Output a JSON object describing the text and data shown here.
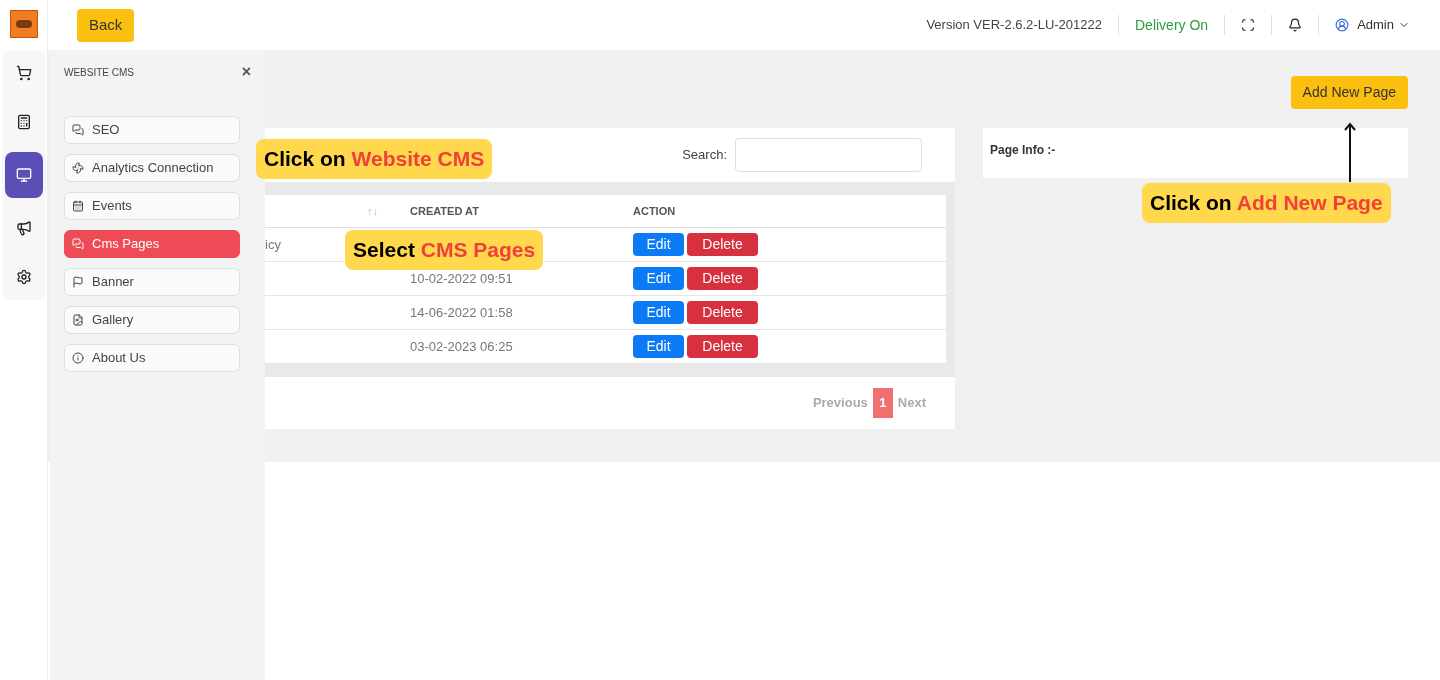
{
  "header": {
    "back": "Back",
    "version": "Version VER-2.6.2-LU-201222",
    "delivery": "Delivery On",
    "user": "Admin"
  },
  "rail": [
    {
      "selected": false
    },
    {
      "selected": false
    },
    {
      "selected": true
    },
    {
      "selected": false
    },
    {
      "selected": false
    }
  ],
  "drawer": {
    "title": "WEBSITE CMS",
    "close": "×",
    "items": [
      {
        "label": "SEO",
        "selected": false
      },
      {
        "label": "Analytics Connection",
        "selected": false
      },
      {
        "label": "Events",
        "selected": false
      },
      {
        "label": "Cms Pages",
        "selected": true
      },
      {
        "label": "Banner",
        "selected": false
      },
      {
        "label": "Gallery",
        "selected": false
      },
      {
        "label": "About Us",
        "selected": false
      }
    ]
  },
  "add_button": "Add New Page",
  "table": {
    "search_label": "Search:",
    "sort_mark": "↑↓",
    "columns": [
      "CREATED AT",
      "ACTION"
    ],
    "rows": [
      {
        "column_1": "icy",
        "created_at": "",
        "edit": "Edit",
        "delete": "Delete"
      },
      {
        "column_1": "",
        "created_at": "10-02-2022 09:51",
        "edit": "Edit",
        "delete": "Delete"
      },
      {
        "column_1": "",
        "created_at": "14-06-2022 01:58",
        "edit": "Edit",
        "delete": "Delete"
      },
      {
        "column_1": "",
        "created_at": "03-02-2023 06:25",
        "edit": "Edit",
        "delete": "Delete"
      }
    ],
    "pagination": {
      "previous": "Previous",
      "pages": [
        {
          "label": "1",
          "selected": true
        }
      ],
      "next": "Next"
    }
  },
  "page_info": "Page Info :-",
  "callouts": [
    {
      "text": "Click on",
      "highlight": "Website CMS"
    },
    {
      "text": "Select",
      "highlight": "CMS Pages"
    },
    {
      "text": "Click on",
      "highlight": "Add New Page"
    }
  ]
}
